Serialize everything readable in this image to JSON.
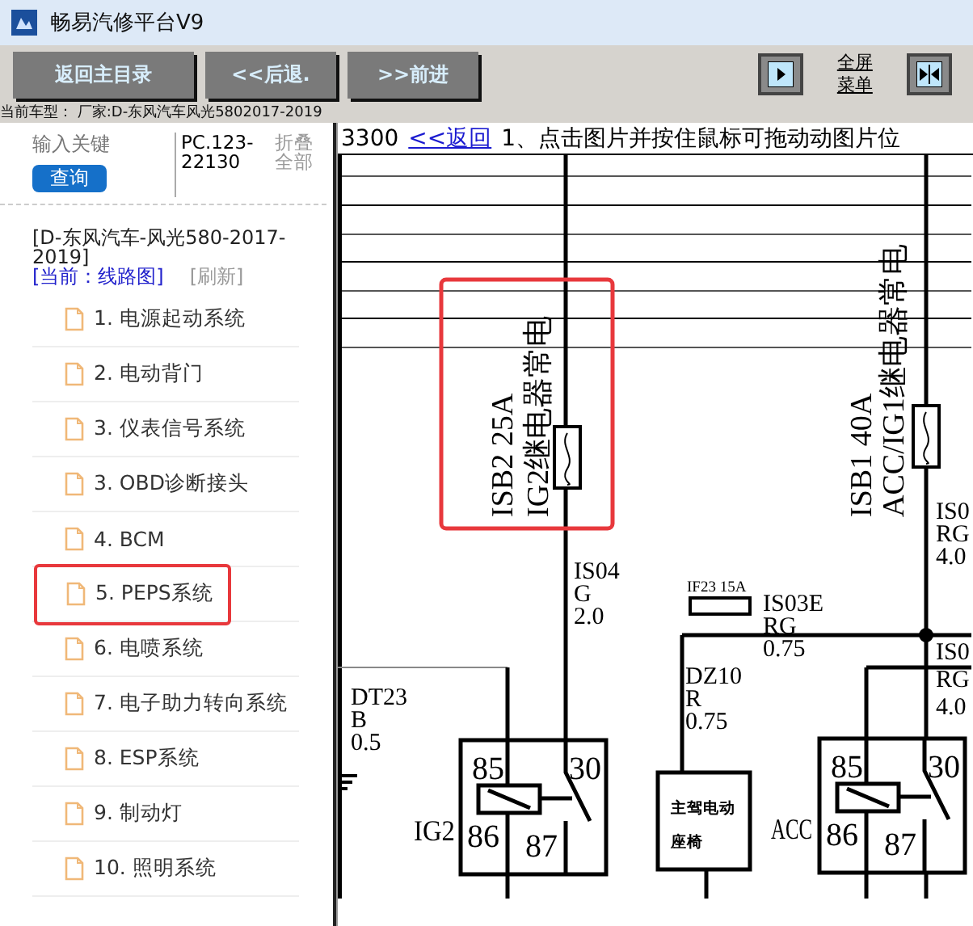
{
  "window": {
    "title": "畅易汽修平台V9"
  },
  "toolbar": {
    "buttons": [
      "返回主目录",
      "<<后退.",
      ">>前进"
    ],
    "fullscreen_menu": "全屏菜单"
  },
  "vehicle_info": "当前车型： 厂家:D-东风汽车风光5802017-2019",
  "search": {
    "placeholder": "输入关键",
    "button": "查询",
    "code": "PC.123-22130",
    "collapse": "折叠全部"
  },
  "tree": {
    "title": "[D-东风汽车-风光580-2017-2019]",
    "current": "[当前：线路图]",
    "refresh": "[刷新]",
    "items": [
      {
        "label": "1. 电源起动系统",
        "highlighted": false
      },
      {
        "label": "2. 电动背门",
        "highlighted": false
      },
      {
        "label": "3. 仪表信号系统",
        "highlighted": false
      },
      {
        "label": "3. OBD诊断接头",
        "highlighted": false
      },
      {
        "label": "4. BCM",
        "highlighted": false
      },
      {
        "label": "5. PEPS系统",
        "highlighted": true
      },
      {
        "label": "6. 电喷系统",
        "highlighted": false
      },
      {
        "label": "7. 电子助力转向系统",
        "highlighted": false
      },
      {
        "label": "8. ESP系统",
        "highlighted": false
      },
      {
        "label": "9. 制动灯",
        "highlighted": false
      },
      {
        "label": "10. 照明系统",
        "highlighted": false
      }
    ]
  },
  "viewer": {
    "page": "3300",
    "back_link": "<<返回",
    "hint": "1、点击图片并按住鼠标可拖动动图片位"
  },
  "diagram": {
    "fuses": [
      {
        "lines": [
          "ISB2 25A",
          "IG2继电器常电"
        ],
        "highlighted": true
      },
      {
        "lines": [
          "ISB1 40A",
          "ACC/IG1继电器常电"
        ],
        "highlighted": false
      }
    ],
    "wire_labels": [
      {
        "lines": [
          "IS04",
          "G",
          "2.0"
        ]
      },
      {
        "lines": [
          "IS0",
          "RG",
          "4.0"
        ]
      },
      {
        "lines": [
          "IS03E",
          "RG",
          "0.75"
        ]
      },
      {
        "lines": [
          "DZ10",
          "R",
          "0.75"
        ]
      },
      {
        "lines": [
          "DT23",
          "B",
          "0.5"
        ]
      },
      {
        "lines": [
          "IS0",
          "RG",
          "4.0"
        ]
      }
    ],
    "inline_fuse": "IF23 15A",
    "component": [
      "主驾电动",
      "座椅"
    ],
    "relays": [
      {
        "name": "IG2",
        "pins": [
          "85",
          "30",
          "86",
          "87"
        ]
      },
      {
        "name": "ACC",
        "pins": [
          "85",
          "30",
          "86",
          "87"
        ]
      }
    ]
  }
}
